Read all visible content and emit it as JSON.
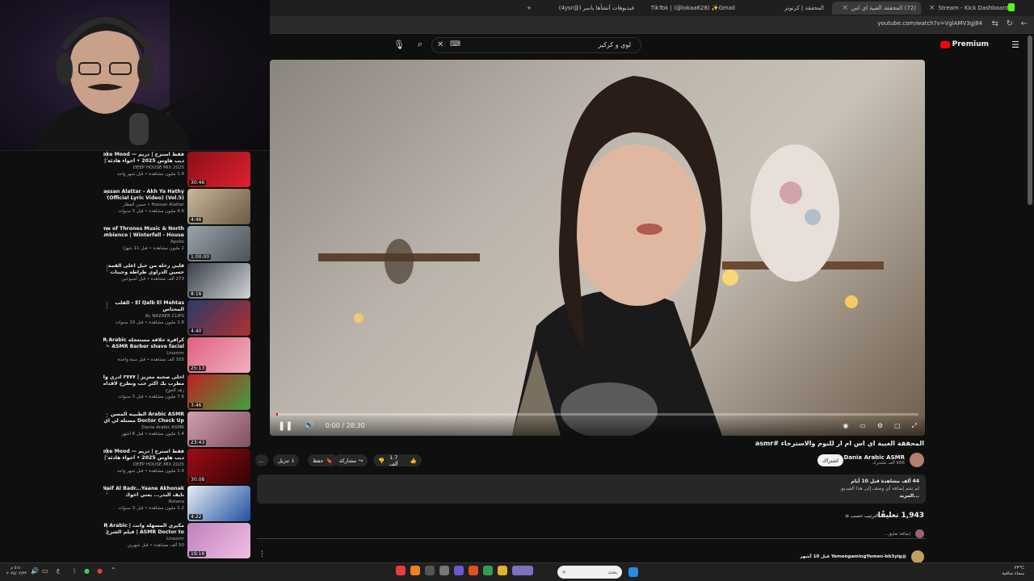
{
  "browser": {
    "tabs": [
      {
        "label": "Stream - Kick Dashboard",
        "active": false
      },
      {
        "label": "(72) المحققة الغبية اي اس",
        "active": true
      },
      {
        "label": "المحققة | كرتونز",
        "active": false
      },
      {
        "label": "TikTok | (@lokaa628) ✨Gmail",
        "active": false
      },
      {
        "label": "فيديوهات أنشأها ياسر (@4ysr)",
        "active": false
      }
    ],
    "new_tab": "+",
    "url": "youtube.com/watch?v=VglAMV3gj84"
  },
  "youtube": {
    "premium_label": "Premium",
    "search_value": "لوي و كركيز",
    "player": {
      "time": "0:00 / 28:30",
      "progress": 0.003
    },
    "video_title": "المحققة الغبية اي اس ام ار للنوم والاسترخاء #asmr",
    "channel": {
      "name": "Dania Arabic ASMR",
      "subs": "666 ألف مشترك",
      "subscribe_label": "اشتراك"
    },
    "actions": {
      "likes": "1.7 ألف",
      "share": "مشاركة",
      "save": "حفظ",
      "download": "تنزيل",
      "more": "..."
    },
    "description": {
      "views_date": "44 ألف مشاهدة قبل 10 أيام",
      "line1": "لم تنتم إضافة أي وصف إلى هذا الفيديو.",
      "more": "...المزيد"
    },
    "comments": {
      "count": "1,943 تعليقًا",
      "sort": "الترتيب حسب",
      "add": "إضافة تعليق...",
      "first_author": "@YemengamingYemen-bb3yig قبل 10 أشهر"
    },
    "recommendations": [
      {
        "t1": "فقط استرخ | دريم — Smoke Mood",
        "t2": "ديب هاوس 2025 • أجواء هادئة | دمعات",
        "ch": "DEEP HOUSE MIX 2025",
        "meta": "1.4 مليون مشاهدة • قبل شهر واحد",
        "dur": "30:46",
        "c1": "#8a0f18",
        "c2": "#e02030"
      },
      {
        "t1": "Hassan Alattar - Akh Ya Hathy",
        "t2": "(Vol.5) (Official Lyric Video)",
        "ch": "Hassan Alattar • حسن العطار",
        "meta": "4.6 مليون مشاهدة • قبل 5 سنوات",
        "dur": "4:46",
        "c1": "#c9b89a",
        "c2": "#6b5a45"
      },
      {
        "t1": "Game of Thrones Music & North",
        "t2": "Ambience | Winterfell - House",
        "ch": "Apollo",
        "meta": "2 مليون مشاهدة • قبل 11 شهرًا",
        "dur": "1:00:00",
        "c1": "#9aa4aa",
        "c2": "#4a5258"
      },
      {
        "t1": "قلبي رحلة من حبل اعلى القمة",
        "t2": "حسين الدراوي طراطة وجينات",
        "ch": "",
        "meta": "273 ألف مشاهدة • قبل أسبوعين",
        "dur": "8:16",
        "c1": "#3a4048",
        "c2": "#d0d4d8"
      },
      {
        "t1": "El Qalb El Mehtas - القلب",
        "t2": "المحتاس",
        "ch": "AL NAZAER CLIPS",
        "meta": "1.8 مليون مشاهدة • قبل 10 سنوات",
        "dur": "4:40",
        "c1": "#2a3a6a",
        "c2": "#b03030"
      },
      {
        "t1": "كرافرة حلاقة مستعجلة ASMR Arabic",
        "t2": "ASMR Barber shave facial ~ جبر",
        "ch": "Linasmr",
        "meta": "105 ألف مشاهدة • قبل سنة واحدة",
        "dur": "25:13",
        "c1": "#e06080",
        "c2": "#f0b0c0"
      },
      {
        "t1": "احلى صحبه معزيز | ٢٧٧٧ ادري وانك على",
        "t2": "مطرب بك اكثر حب ونطرح لاقدامي ...",
        "ch": "زهد الجوع",
        "meta": "7.6 مليون مشاهدة • قبل 5 سنوات",
        "dur": "3:46",
        "c1": "#c02020",
        "c2": "#40a040"
      },
      {
        "t1": "Arabic ASMR الطبيبة المسن",
        "t2": "Doctor Check Up مستلة لي اي اي ار",
        "ch": "Dania Arabic ASMR",
        "meta": "1.4 مليون مشاهدة • قبل 6 أشهر",
        "dur": "23:43",
        "c1": "#d0a0b0",
        "c2": "#805060"
      },
      {
        "t1": "فقط استرخ | دريم — Smoke Mood",
        "t2": "ديب هاوس 2025 • أجواء هادئة | دمعات",
        "ch": "DEEP HOUSE MIX 2025",
        "meta": "1.4 مليون مشاهدة • قبل شهر واحد",
        "dur": "30:08",
        "c1": "#a00c14",
        "c2": "#300406"
      },
      {
        "t1": "Naif Al Badr...Yaane Akhonak |",
        "t2": "نايف البدر... يعني أخوك",
        "ch": "Rotana",
        "meta": "1.2 مليون مشاهدة • قبل 3 سنوات",
        "dur": "4:22",
        "c1": "#e8eef4",
        "c2": "#2050a0"
      },
      {
        "t1": "مكيري المسهلة وانت | ASMR Arabic",
        "t2": "ASMR Doctor to | فيلم الشرخ",
        "ch": "Linasmr",
        "meta": "50 ألف مشاهدة • قبل شهرين",
        "dur": "19:16",
        "c1": "#c080c0",
        "c2": "#f0c0e0"
      }
    ]
  },
  "taskbar": {
    "search_placeholder": "بحث",
    "time": "٥:٤٠ م",
    "date": "٢٠٢٥/٠٢/٢٣",
    "weather": "٢٣°C",
    "weather_desc": "سماء صافية",
    "lang": "ع"
  },
  "colors": {
    "accent": "#ff0000",
    "bg": "#0f0f0f",
    "surface": "#272727"
  }
}
